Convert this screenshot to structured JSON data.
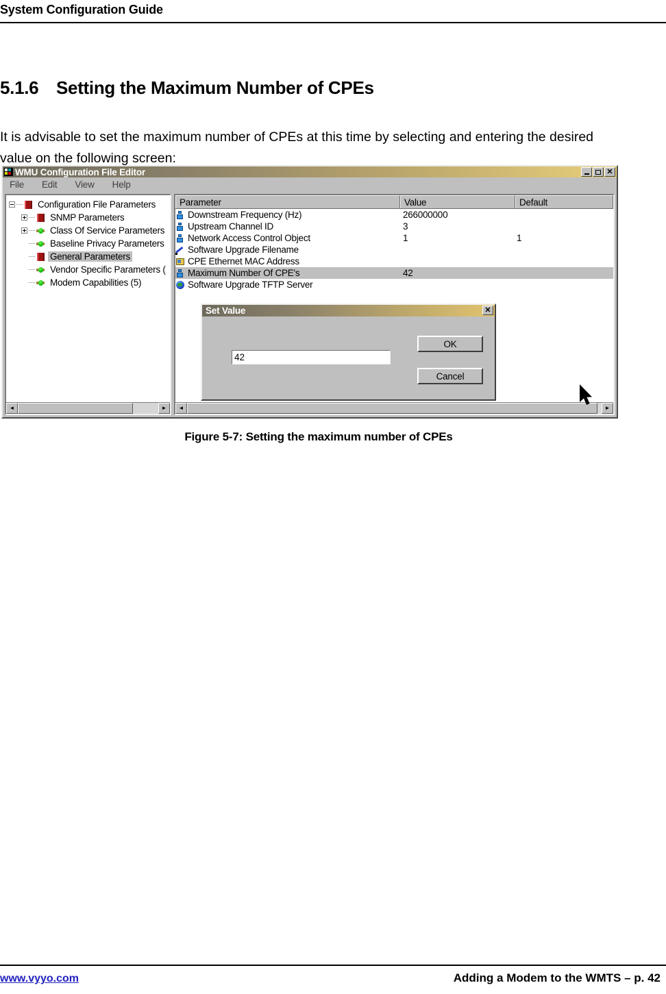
{
  "document": {
    "header_title": "System Configuration Guide",
    "section_number": "5.1.6",
    "section_title": "Setting the Maximum Number of CPEs",
    "intro_paragraph": "It is advisable to set the maximum number of CPEs at this time by selecting and entering the desired value on the following screen:",
    "figure_caption": "Figure 5-7: Setting the maximum number of CPEs",
    "footer_link": "www.vyyo.com",
    "footer_right": "Adding a Modem to the WMTS – p. 42"
  },
  "app": {
    "title": "WMU Configuration File Editor",
    "title_icon": "windows-logo-icon",
    "window_buttons": {
      "minimize": "_",
      "maximize": "□",
      "close": "✕"
    },
    "menu": [
      {
        "label": "File"
      },
      {
        "label": "Edit"
      },
      {
        "label": "View"
      },
      {
        "label": "Help"
      }
    ],
    "tree": {
      "items": [
        {
          "label": "Configuration File Parameters",
          "icon": "red-book-icon",
          "depth": 0,
          "expander": "minus",
          "selected": false
        },
        {
          "label": "SNMP Parameters",
          "icon": "red-book-icon",
          "depth": 1,
          "expander": "plus",
          "selected": false
        },
        {
          "label": "Class Of Service Parameters",
          "icon": "green-node-icon",
          "depth": 1,
          "expander": "plus",
          "selected": false
        },
        {
          "label": "Baseline Privacy Parameters",
          "icon": "green-node-icon",
          "depth": 1,
          "expander": "none",
          "selected": false
        },
        {
          "label": "General Parameters",
          "icon": "red-book-icon",
          "depth": 1,
          "expander": "none",
          "selected": true
        },
        {
          "label": "Vendor Specific Parameters (",
          "icon": "green-node-icon",
          "depth": 1,
          "expander": "none",
          "selected": false
        },
        {
          "label": "Modem Capabilities (5)",
          "icon": "green-node-icon",
          "depth": 1,
          "expander": "none",
          "selected": false
        }
      ]
    },
    "list": {
      "columns": [
        {
          "label": "Parameter"
        },
        {
          "label": "Value"
        },
        {
          "label": "Default"
        }
      ],
      "rows": [
        {
          "icon": "person-icon",
          "parameter": "Downstream Frequency  (Hz)",
          "value": "266000000",
          "default": "",
          "selected": false
        },
        {
          "icon": "person-icon",
          "parameter": "Upstream Channel ID",
          "value": "3",
          "default": "",
          "selected": false
        },
        {
          "icon": "person-icon",
          "parameter": "Network Access Control Object",
          "value": "1",
          "default": "1",
          "selected": false
        },
        {
          "icon": "pencil-icon",
          "parameter": "Software Upgrade Filename",
          "value": "",
          "default": "",
          "selected": false
        },
        {
          "icon": "card-icon",
          "parameter": "CPE Ethernet MAC Address",
          "value": "",
          "default": "",
          "selected": false
        },
        {
          "icon": "person-icon",
          "parameter": "Maximum Number Of CPE's",
          "value": "42",
          "default": "",
          "selected": true
        },
        {
          "icon": "globe-icon",
          "parameter": "Software Upgrade TFTP Server",
          "value": "",
          "default": "",
          "selected": false
        }
      ]
    },
    "dialog": {
      "title": "Set Value",
      "close_label": "✕",
      "input_value": "42",
      "ok_label": "OK",
      "cancel_label": "Cancel"
    },
    "scrollbars": {
      "left_arrow": "◄",
      "right_arrow": "►"
    }
  }
}
